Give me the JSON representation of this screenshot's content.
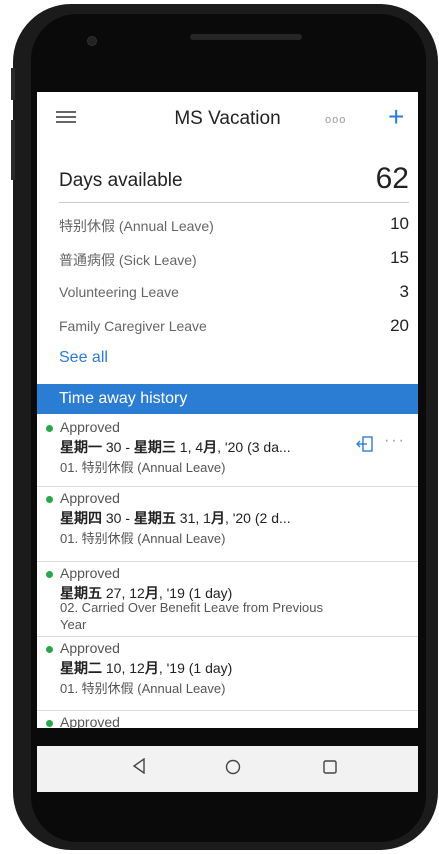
{
  "app": {
    "title": "MS Vacation"
  },
  "header": {
    "menu_icon": "hamburger-icon",
    "more_label": "ooo",
    "add_label": "+"
  },
  "balance": {
    "title": "Days available",
    "total": "62",
    "items": [
      {
        "label": "特别休假 (Annual Leave)",
        "value": "10"
      },
      {
        "label": "普通病假 (Sick Leave)",
        "value": "15"
      },
      {
        "label": "Volunteering Leave",
        "value": "3"
      },
      {
        "label": "Family Caregiver Leave",
        "value": "20"
      }
    ],
    "see_all": "See all"
  },
  "history": {
    "title": "Time away history",
    "entries": [
      {
        "status": "Approved",
        "dates_bold_a": "星期一",
        "dates_a": " 30 - ",
        "dates_bold_b": "星期三",
        "dates_b": " 1, 4",
        "dates_bold_c": "月",
        "dates_c": ", '20 (3 da...",
        "type": "01. 特别休假 (Annual Leave)",
        "type2": ""
      },
      {
        "status": "Approved",
        "dates_bold_a": "星期四",
        "dates_a": " 30 - ",
        "dates_bold_b": "星期五",
        "dates_b": " 31, 1",
        "dates_bold_c": "月",
        "dates_c": ", '20 (2 d...",
        "type": "01. 特别休假 (Annual Leave)",
        "type2": ""
      },
      {
        "status": "Approved",
        "dates_bold_a": "星期五",
        "dates_a": " 27, 12",
        "dates_bold_b": "月",
        "dates_b": ", '19 (1 day)",
        "dates_bold_c": "",
        "dates_c": "",
        "type": "02. Carried Over Benefit Leave from Previous",
        "type2": "Year"
      },
      {
        "status": "Approved",
        "dates_bold_a": "星期二",
        "dates_a": " 10, 12",
        "dates_bold_b": "月",
        "dates_b": ", '19 (1 day)",
        "dates_bold_c": "",
        "dates_c": "",
        "type": "01. 特别休假 (Annual Leave)",
        "type2": ""
      },
      {
        "status": "Approved",
        "dates_bold_a": "",
        "dates_a": "",
        "dates_bold_b": "",
        "dates_b": "",
        "dates_bold_c": "",
        "dates_c": "",
        "type": "",
        "type2": ""
      }
    ],
    "action_icon": "export-icon",
    "more_label": "···"
  },
  "navbar": {
    "back": "◁",
    "home": "○",
    "recents": "□"
  },
  "colors": {
    "accent": "#2b7cd3",
    "approved": "#2aa64b"
  }
}
